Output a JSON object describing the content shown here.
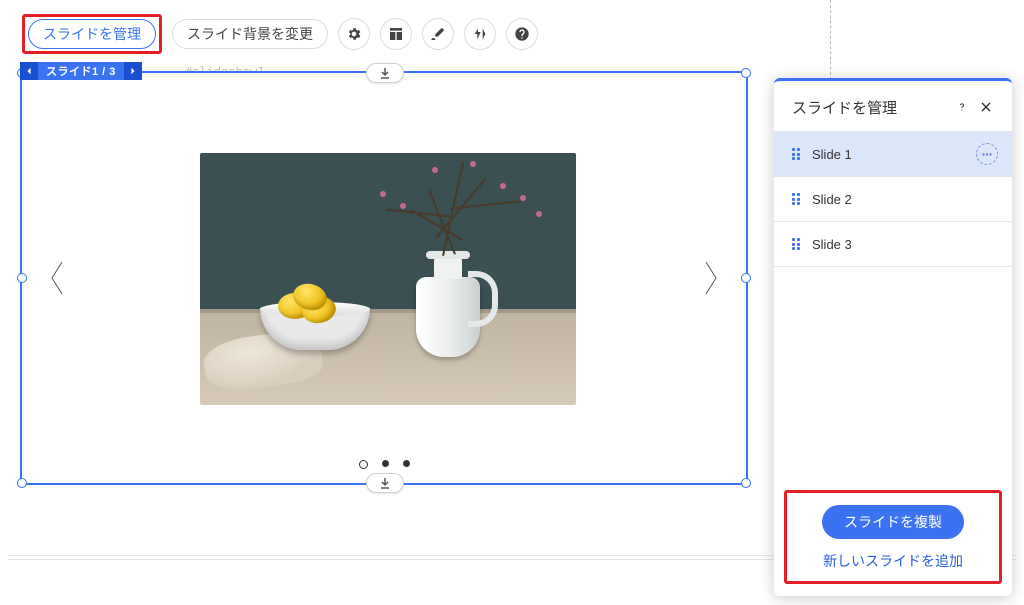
{
  "toolbar": {
    "manage_slides": "スライドを管理",
    "change_background": "スライド背景を変更"
  },
  "slide_indicator": {
    "label": "スライド1 / 3"
  },
  "element_hash": "#slideshow1",
  "panel": {
    "title": "スライドを管理",
    "slides": [
      {
        "name": "Slide 1"
      },
      {
        "name": "Slide 2"
      },
      {
        "name": "Slide 3"
      }
    ],
    "duplicate": "スライドを複製",
    "add_new": "新しいスライドを追加"
  }
}
